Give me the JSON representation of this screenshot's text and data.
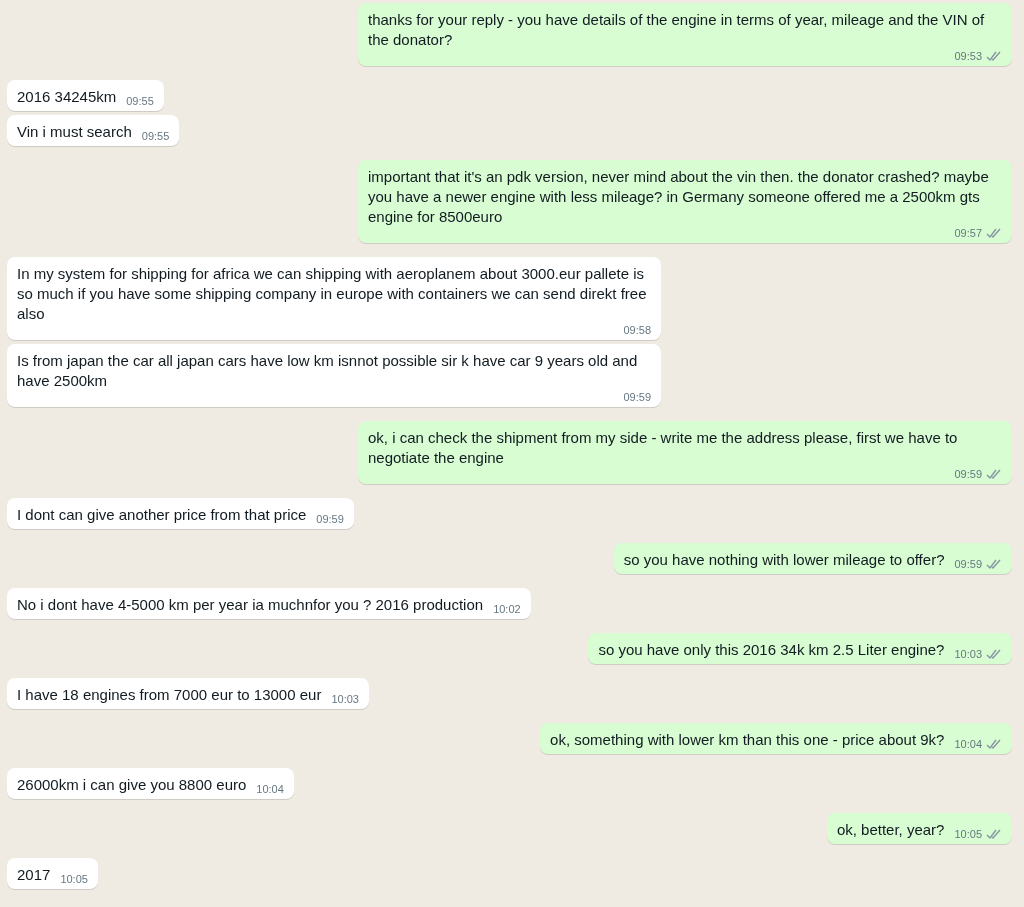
{
  "messages": [
    {
      "outgoing": true,
      "text": "thanks for your reply - you have details of the engine in terms of year, mileage and the VIN of the donator?",
      "time": "09:53",
      "delivered": true
    },
    {
      "outgoing": false,
      "text": "2016 34245km",
      "time": "09:55"
    },
    {
      "outgoing": false,
      "text": "Vin  i must search",
      "time": "09:55"
    },
    {
      "outgoing": true,
      "text": "important that it's an pdk version, never mind about the vin then. the donator crashed? maybe you have a newer engine with less mileage? in Germany someone offered me a 2500km gts  engine for 8500euro",
      "time": "09:57",
      "delivered": true
    },
    {
      "outgoing": false,
      "text": "In my system for shipping for africa we can shipping with aeroplanem about 3000.eur pallete is so much if you have some shipping company in europe with containers we can send direkt free also",
      "time": "09:58"
    },
    {
      "outgoing": false,
      "text": "Is from japan the car all japan cars have low km isnnot possible sir k have car 9 years old and have 2500km",
      "time": "09:59"
    },
    {
      "outgoing": true,
      "text": "ok, i can check the shipment from my side - write me the address please, first we have to negotiate the engine",
      "time": "09:59",
      "delivered": true
    },
    {
      "outgoing": false,
      "text": "I dont can give another price from that price",
      "time": "09:59"
    },
    {
      "outgoing": true,
      "text": "so you have nothing with lower mileage to offer?",
      "time": "09:59",
      "delivered": true
    },
    {
      "outgoing": false,
      "text": "No i dont have  4-5000 km per year ia muchnfor you ? 2016 production",
      "time": "10:02"
    },
    {
      "outgoing": true,
      "text": "so you have only this 2016 34k km 2.5 Liter engine?",
      "time": "10:03",
      "delivered": true
    },
    {
      "outgoing": false,
      "text": "I have 18 engines from 7000 eur to 13000 eur",
      "time": "10:03"
    },
    {
      "outgoing": true,
      "text": "ok, something with lower km than this one - price about 9k?",
      "time": "10:04",
      "delivered": true
    },
    {
      "outgoing": false,
      "text": "26000km i can give you 8800 euro",
      "time": "10:04"
    },
    {
      "outgoing": true,
      "text": "ok, better, year?",
      "time": "10:05",
      "delivered": true
    },
    {
      "outgoing": false,
      "text": "2017",
      "time": "10:05"
    }
  ]
}
